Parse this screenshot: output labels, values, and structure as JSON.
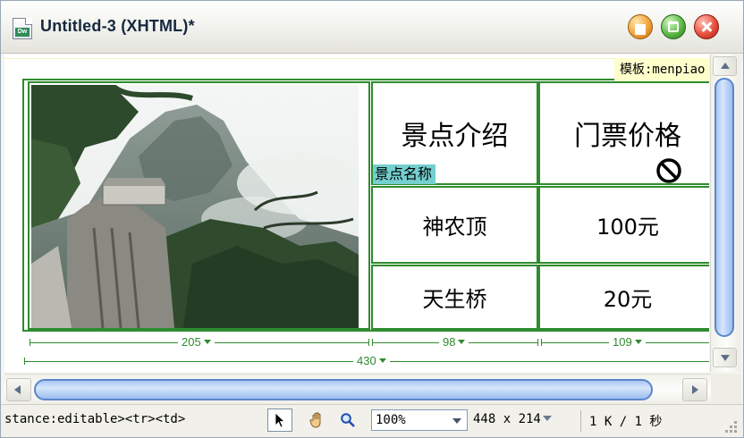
{
  "window": {
    "title": "Untitled-3 (XHTML)*",
    "app_icon_text": "Dw"
  },
  "design": {
    "template_badge": "模板:menpiao",
    "table": {
      "headers": [
        "景点介绍",
        "门票价格"
      ],
      "editable_region": "景点名称",
      "rows": [
        {
          "name": "神农顶",
          "price": "100元"
        },
        {
          "name": "天生桥",
          "price": "20元"
        }
      ]
    },
    "width_guides": {
      "col1": "205",
      "col2": "98",
      "col3": "109",
      "total": "430"
    }
  },
  "statusbar": {
    "tag_selector": "stance:editable><tr><td>",
    "zoom": "100%",
    "window_size": "448 x 214",
    "download_info": "1 K / 1 秒"
  },
  "colors": {
    "table_border": "#2e8b2e",
    "editable_tag_bg": "#74cfcf",
    "template_badge_bg": "#ffffcc",
    "scroll_thumb": "#a8c6f3"
  }
}
